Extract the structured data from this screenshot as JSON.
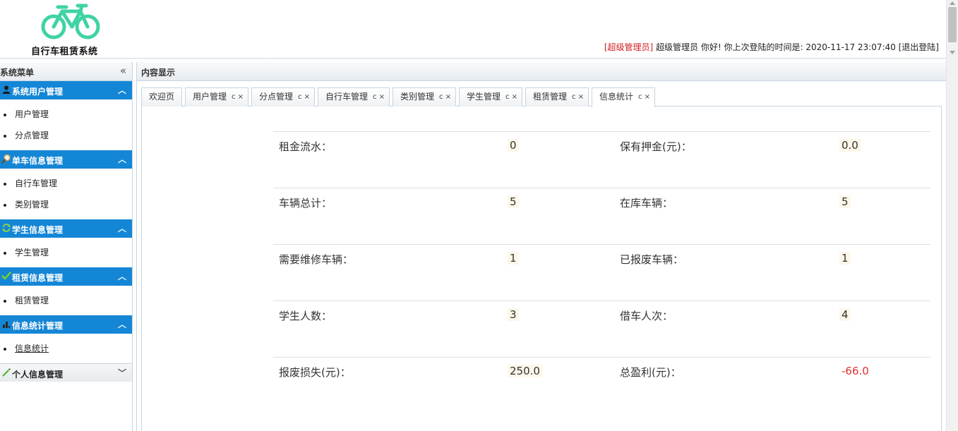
{
  "header": {
    "logo_text": "自行车租赁系统",
    "role": "[超级管理员]",
    "greeting": " 超级管理员 你好! 你上次登陆的时间是: ",
    "last_login": "2020-11-17 23:07:40",
    "logout": " [退出登陆]",
    "brand_color": "#3fd3a5"
  },
  "sidebar": {
    "title": "系统菜单",
    "collapse_glyph": "«",
    "groups": [
      {
        "label": "系统用户管理",
        "icon": "user-icon",
        "items": [
          "用户管理",
          "分点管理"
        ]
      },
      {
        "label": "单车信息管理",
        "icon": "magnifier-icon",
        "items": [
          "自行车管理",
          "类别管理"
        ]
      },
      {
        "label": "学生信息管理",
        "icon": "refresh-icon",
        "items": [
          "学生管理"
        ]
      },
      {
        "label": "租赁信息管理",
        "icon": "checkmark-icon",
        "items": [
          "租赁管理"
        ]
      },
      {
        "label": "信息统计管理",
        "icon": "chart-icon",
        "items": [
          "信息统计"
        ]
      },
      {
        "label": "个人信息管理",
        "icon": "pencil-icon",
        "items": []
      }
    ],
    "accent_color": "#1486d6"
  },
  "content": {
    "title": "内容显示",
    "tabs": [
      {
        "label": "欢迎页"
      },
      {
        "label": "用户管理",
        "controls": "c ×"
      },
      {
        "label": "分点管理",
        "controls": "c ×"
      },
      {
        "label": "自行车管理",
        "controls": "c ×"
      },
      {
        "label": "类别管理",
        "controls": "c ×"
      },
      {
        "label": "学生管理",
        "controls": "c ×"
      },
      {
        "label": "租赁管理",
        "controls": "c ×"
      },
      {
        "label": "信息统计",
        "controls": "c ×"
      }
    ],
    "stats": [
      {
        "left_label": "租金流水：",
        "left_value": "0",
        "right_label": "保有押金(元)：",
        "right_value": "0.0"
      },
      {
        "left_label": "车辆总计：",
        "left_value": "5",
        "right_label": "在库车辆：",
        "right_value": "5"
      },
      {
        "left_label": "需要维修车辆：",
        "left_value": "1",
        "right_label": "已报废车辆：",
        "right_value": "1"
      },
      {
        "left_label": "学生人数：",
        "left_value": "3",
        "right_label": "借车人次：",
        "right_value": "4"
      },
      {
        "left_label": "报废损失(元)：",
        "left_value": "250.0",
        "right_label": "总盈利(元)：",
        "right_value": "-66.0"
      }
    ]
  }
}
